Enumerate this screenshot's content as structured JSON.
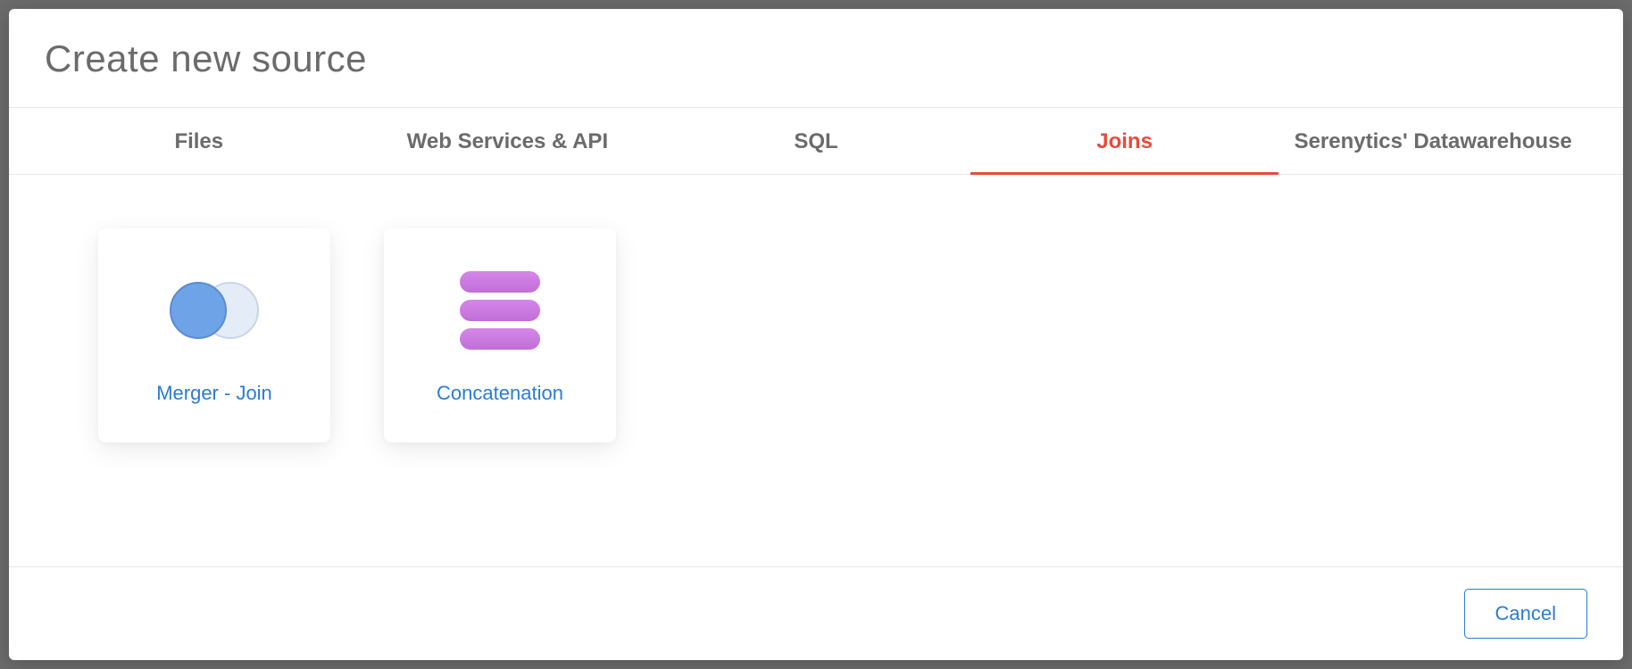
{
  "modal": {
    "title": "Create new source"
  },
  "tabs": [
    {
      "label": "Files",
      "active": false
    },
    {
      "label": "Web Services & API",
      "active": false
    },
    {
      "label": "SQL",
      "active": false
    },
    {
      "label": "Joins",
      "active": true
    },
    {
      "label": "Serenytics' Datawarehouse",
      "active": false
    }
  ],
  "sources": [
    {
      "label": "Merger - Join",
      "icon": "venn"
    },
    {
      "label": "Concatenation",
      "icon": "concat"
    }
  ],
  "footer": {
    "cancel_label": "Cancel"
  }
}
